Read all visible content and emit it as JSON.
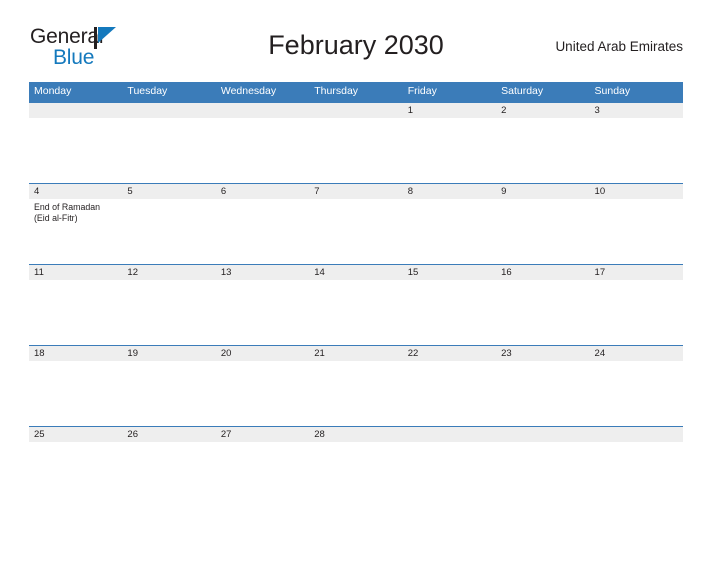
{
  "branding": {
    "logo_text_primary": "General",
    "logo_text_secondary": "Blue",
    "logo_icon": "triangle-flag-icon",
    "accent_color": "#1479bd"
  },
  "header": {
    "title": "February 2030",
    "country": "United Arab Emirates"
  },
  "theme": {
    "header_blue": "#3b7cb9",
    "daynum_band": "#eeeeee",
    "page_background": "#ffffff",
    "text_color": "#231f20"
  },
  "calendar": {
    "weekday_headers": [
      "Monday",
      "Tuesday",
      "Wednesday",
      "Thursday",
      "Friday",
      "Saturday",
      "Sunday"
    ],
    "weeks": [
      [
        {
          "day": "",
          "events": []
        },
        {
          "day": "",
          "events": []
        },
        {
          "day": "",
          "events": []
        },
        {
          "day": "",
          "events": []
        },
        {
          "day": "1",
          "events": []
        },
        {
          "day": "2",
          "events": []
        },
        {
          "day": "3",
          "events": []
        }
      ],
      [
        {
          "day": "4",
          "events": [
            "End of Ramadan",
            "(Eid al-Fitr)"
          ]
        },
        {
          "day": "5",
          "events": []
        },
        {
          "day": "6",
          "events": []
        },
        {
          "day": "7",
          "events": []
        },
        {
          "day": "8",
          "events": []
        },
        {
          "day": "9",
          "events": []
        },
        {
          "day": "10",
          "events": []
        }
      ],
      [
        {
          "day": "11",
          "events": []
        },
        {
          "day": "12",
          "events": []
        },
        {
          "day": "13",
          "events": []
        },
        {
          "day": "14",
          "events": []
        },
        {
          "day": "15",
          "events": []
        },
        {
          "day": "16",
          "events": []
        },
        {
          "day": "17",
          "events": []
        }
      ],
      [
        {
          "day": "18",
          "events": []
        },
        {
          "day": "19",
          "events": []
        },
        {
          "day": "20",
          "events": []
        },
        {
          "day": "21",
          "events": []
        },
        {
          "day": "22",
          "events": []
        },
        {
          "day": "23",
          "events": []
        },
        {
          "day": "24",
          "events": []
        }
      ],
      [
        {
          "day": "25",
          "events": []
        },
        {
          "day": "26",
          "events": []
        },
        {
          "day": "27",
          "events": []
        },
        {
          "day": "28",
          "events": []
        },
        {
          "day": "",
          "events": []
        },
        {
          "day": "",
          "events": []
        },
        {
          "day": "",
          "events": []
        }
      ]
    ]
  }
}
